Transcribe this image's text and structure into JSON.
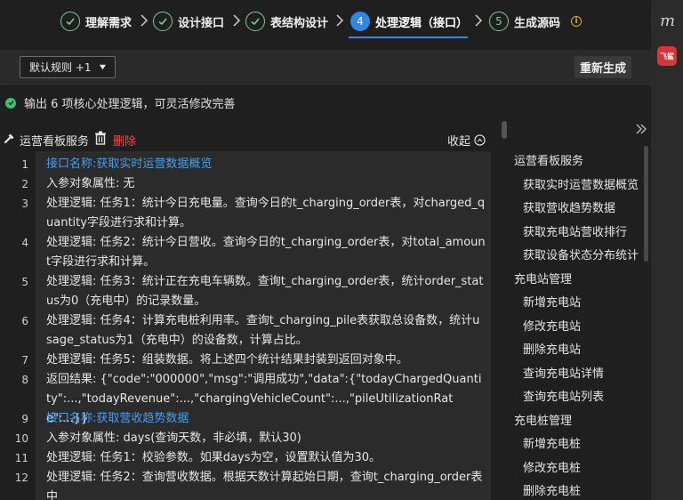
{
  "stepper": {
    "steps": [
      {
        "label": "理解需求",
        "state": "done"
      },
      {
        "label": "设计接口",
        "state": "done"
      },
      {
        "label": "表结构设计",
        "state": "done"
      },
      {
        "label": "处理逻辑（接口）",
        "state": "active",
        "number": "4"
      },
      {
        "label": "生成源码",
        "state": "pending",
        "number": "5"
      }
    ],
    "info_icon": "info-icon"
  },
  "rail": {
    "letter": "m",
    "app_badge": "飞鲨"
  },
  "toolbar": {
    "rule_select": "默认规则 +1",
    "regenerate_label": "重新生成"
  },
  "status": {
    "text": "输出 6 项核心处理逻辑，可灵活修改完善",
    "color": "#3fbf6f"
  },
  "editor_header": {
    "service_label": "运营看板服务",
    "delete_label": "删除",
    "collapse_label": "收起"
  },
  "editor": {
    "lines": [
      {
        "n": "1",
        "text": "接口名称:获取实时运营数据概览",
        "kind": "heading"
      },
      {
        "n": "2",
        "text": "入参对象属性: 无",
        "kind": "text"
      },
      {
        "n": "3",
        "text": "处理逻辑: 任务1：统计今日充电量。查询今日的t_charging_order表，对charged_quantity字段进行求和计算。",
        "kind": "text"
      },
      {
        "n": "4",
        "text": "处理逻辑: 任务2：统计今日营收。查询今日的t_charging_order表，对total_amount字段进行求和计算。",
        "kind": "text"
      },
      {
        "n": "5",
        "text": "处理逻辑: 任务3：统计正在充电车辆数。查询t_charging_order表，统计order_status为0（充电中）的记录数量。",
        "kind": "text"
      },
      {
        "n": "6",
        "text": "处理逻辑: 任务4：计算充电桩利用率。查询t_charging_pile表获取总设备数，统计usage_status为1（充电中）的设备数，计算占比。",
        "kind": "text"
      },
      {
        "n": "7",
        "text": "处理逻辑: 任务5：组装数据。将上述四个统计结果封装到返回对象中。",
        "kind": "text"
      },
      {
        "n": "8",
        "text": "返回结果: {\"code\":\"000000\",\"msg\":\"调用成功\",\"data\":{\"todayChargedQuantity\":...,\"todayRevenue\":...,\"chargingVehicleCount\":...,\"pileUtilizationRate\":...}}",
        "kind": "text"
      },
      {
        "n": "9",
        "text": "接口名称:获取营收趋势数据",
        "kind": "heading"
      },
      {
        "n": "10",
        "text": "入参对象属性: days(查询天数，非必填，默认30)",
        "kind": "text"
      },
      {
        "n": "11",
        "text": "处理逻辑: 任务1：校验参数。如果days为空，设置默认值为30。",
        "kind": "text"
      },
      {
        "n": "12",
        "text": "处理逻辑: 任务2：查询营收数据。根据天数计算起始日期，查询t_charging_order表中",
        "kind": "text"
      }
    ]
  },
  "tree": {
    "groups": [
      {
        "label": "运营看板服务",
        "items": [
          "获取实时运营数据概览",
          "获取营收趋势数据",
          "获取充电站营收排行",
          "获取设备状态分布统计"
        ]
      },
      {
        "label": "充电站管理",
        "items": [
          "新增充电站",
          "修改充电站",
          "删除充电站",
          "查询充电站详情",
          "查询充电站列表"
        ]
      },
      {
        "label": "充电桩管理",
        "items": [
          "新增充电桩",
          "修改充电桩",
          "删除充电桩"
        ]
      }
    ]
  }
}
